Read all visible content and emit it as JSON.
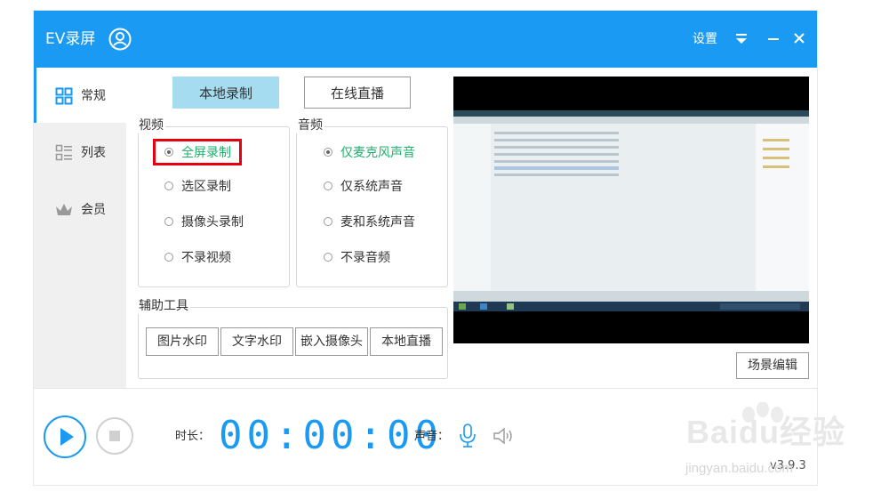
{
  "app": {
    "title": "EV录屏"
  },
  "titlebar": {
    "settings_label": "设置"
  },
  "sidebar": {
    "items": [
      {
        "label": "常规",
        "icon": "grid-icon",
        "active": true
      },
      {
        "label": "列表",
        "icon": "list-icon",
        "active": false
      },
      {
        "label": "会员",
        "icon": "crown-icon",
        "active": false
      }
    ]
  },
  "tabs": [
    {
      "label": "本地录制",
      "active": true
    },
    {
      "label": "在线直播",
      "active": false
    }
  ],
  "video": {
    "title": "视频",
    "options": [
      "全屏录制",
      "选区录制",
      "摄像头录制",
      "不录视频"
    ],
    "selected": "全屏录制"
  },
  "audio": {
    "title": "音频",
    "options": [
      "仅麦克风声音",
      "仅系统声音",
      "麦和系统声音",
      "不录音频"
    ],
    "selected": "仅麦克风声音"
  },
  "tools": {
    "title": "辅助工具",
    "buttons": [
      "图片水印",
      "文字水印",
      "嵌入摄像头",
      "本地直播"
    ]
  },
  "scene_edit_label": "场景编辑",
  "bottom": {
    "duration_label": "时长：",
    "timer": "00:00:00",
    "sound_label": "声音：",
    "version": "v3.9.3"
  },
  "watermark": {
    "text": "Baidu经验",
    "sub": "jingyan.baidu.com"
  },
  "colors": {
    "accent": "#1a9af2",
    "checked_text": "#1eb26b",
    "highlight": "#e60012",
    "tab_active": "#a6dcef"
  }
}
